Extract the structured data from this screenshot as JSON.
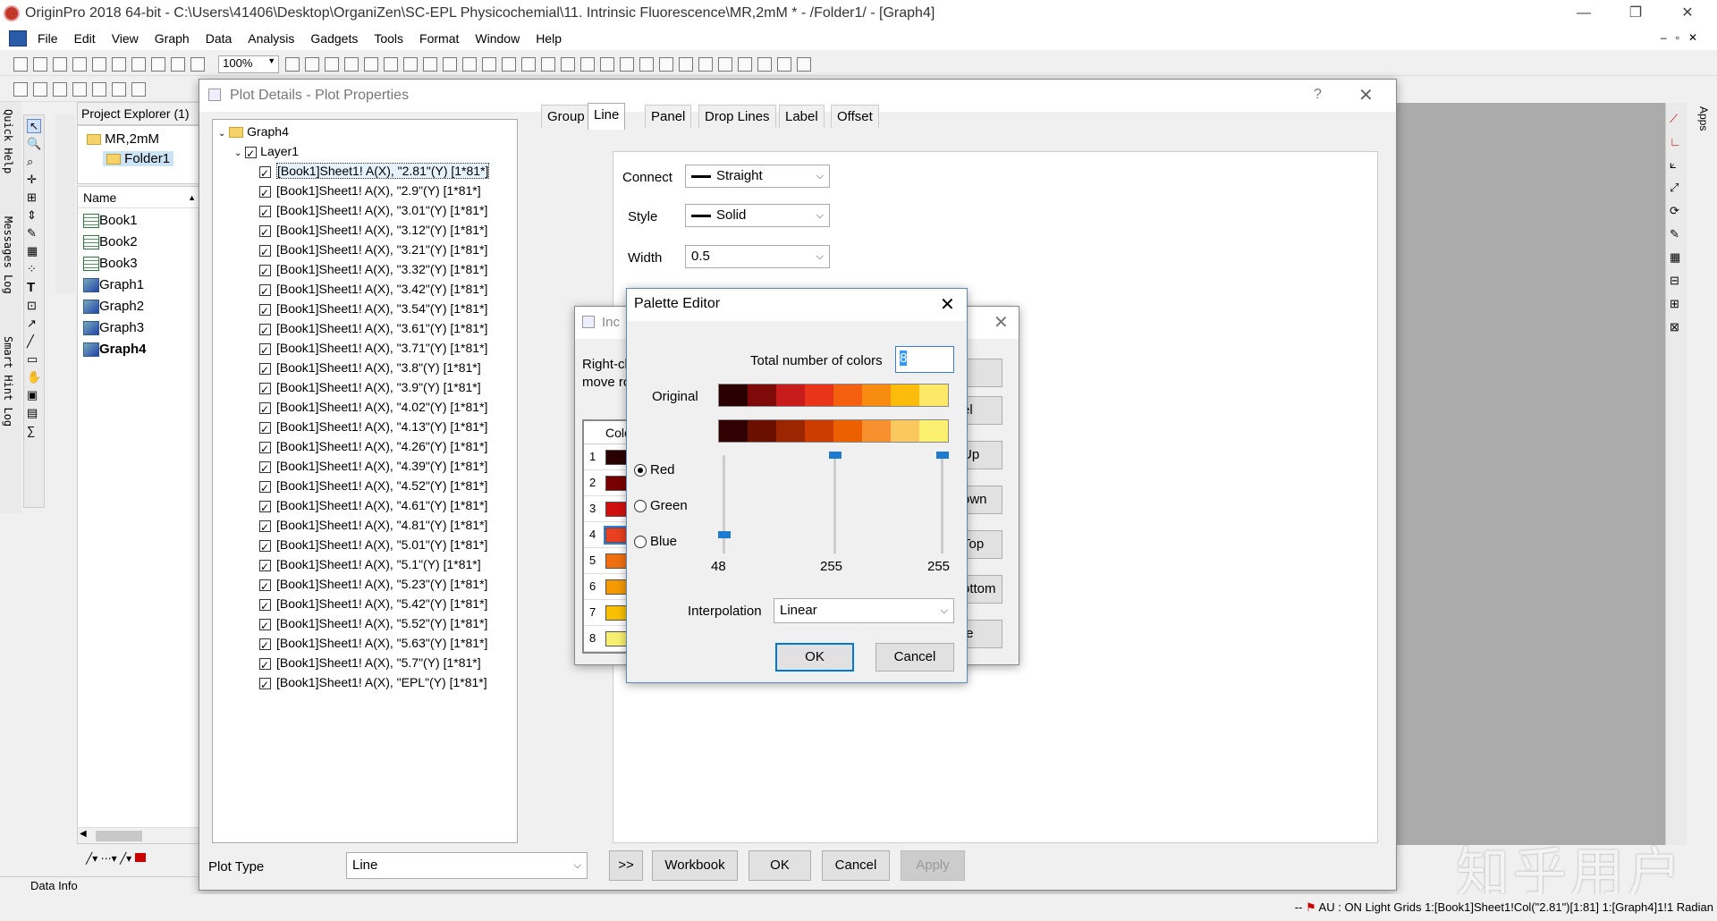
{
  "window": {
    "title": "OriginPro 2018 64-bit - C:\\Users\\41406\\Desktop\\OrganiZen\\SC-EPL Physicochemial\\11. Intrinsic Fluorescence\\MR,2mM * - /Folder1/ - [Graph4]"
  },
  "menu": [
    "File",
    "Edit",
    "View",
    "Graph",
    "Data",
    "Analysis",
    "Gadgets",
    "Tools",
    "Format",
    "Window",
    "Help"
  ],
  "toolbar": {
    "zoom": "100%"
  },
  "side_labels": {
    "quick_help": "Quick Help",
    "messages_log": "Messages Log",
    "smart_hint_log": "Smart Hint Log",
    "apps": "Apps"
  },
  "project_explorer": {
    "title": "Project Explorer (1)",
    "root": "MR,2mM",
    "folder": "Folder1",
    "name_header": "Name",
    "items": [
      "Book1",
      "Book2",
      "Book3",
      "Graph1",
      "Graph2",
      "Graph3",
      "Graph4"
    ]
  },
  "plot_details": {
    "title": "Plot Details - Plot Properties",
    "help": "?",
    "tree_root": "Graph4",
    "layer": "Layer1",
    "plots": [
      "[Book1]Sheet1! A(X), \"2.81\"(Y) [1*81*]",
      "[Book1]Sheet1! A(X), \"2.9\"(Y) [1*81*]",
      "[Book1]Sheet1! A(X), \"3.01\"(Y) [1*81*]",
      "[Book1]Sheet1! A(X), \"3.12\"(Y) [1*81*]",
      "[Book1]Sheet1! A(X), \"3.21\"(Y) [1*81*]",
      "[Book1]Sheet1! A(X), \"3.32\"(Y) [1*81*]",
      "[Book1]Sheet1! A(X), \"3.42\"(Y) [1*81*]",
      "[Book1]Sheet1! A(X), \"3.54\"(Y) [1*81*]",
      "[Book1]Sheet1! A(X), \"3.61\"(Y) [1*81*]",
      "[Book1]Sheet1! A(X), \"3.71\"(Y) [1*81*]",
      "[Book1]Sheet1! A(X), \"3.8\"(Y) [1*81*]",
      "[Book1]Sheet1! A(X), \"3.9\"(Y) [1*81*]",
      "[Book1]Sheet1! A(X), \"4.02\"(Y) [1*81*]",
      "[Book1]Sheet1! A(X), \"4.13\"(Y) [1*81*]",
      "[Book1]Sheet1! A(X), \"4.26\"(Y) [1*81*]",
      "[Book1]Sheet1! A(X), \"4.39\"(Y) [1*81*]",
      "[Book1]Sheet1! A(X), \"4.52\"(Y) [1*81*]",
      "[Book1]Sheet1! A(X), \"4.61\"(Y) [1*81*]",
      "[Book1]Sheet1! A(X), \"4.81\"(Y) [1*81*]",
      "[Book1]Sheet1! A(X), \"5.01\"(Y) [1*81*]",
      "[Book1]Sheet1! A(X), \"5.1\"(Y) [1*81*]",
      "[Book1]Sheet1! A(X), \"5.23\"(Y) [1*81*]",
      "[Book1]Sheet1! A(X), \"5.42\"(Y) [1*81*]",
      "[Book1]Sheet1! A(X), \"5.52\"(Y) [1*81*]",
      "[Book1]Sheet1! A(X), \"5.63\"(Y) [1*81*]",
      "[Book1]Sheet1! A(X), \"5.7\"(Y) [1*81*]",
      "[Book1]Sheet1! A(X), \"EPL\"(Y) [1*81*]"
    ],
    "tabs": [
      "Group",
      "Line",
      "Panel",
      "Drop Lines",
      "Label",
      "Offset"
    ],
    "connect_label": "Connect",
    "connect_value": "Straight",
    "style_label": "Style",
    "style_value": "Solid",
    "width_label": "Width",
    "width_value": "0.5",
    "plot_type_label": "Plot Type",
    "plot_type_value": "Line",
    "buttons": {
      "more": ">>",
      "workbook": "Workbook",
      "ok": "OK",
      "cancel": "Cancel",
      "apply": "Apply"
    }
  },
  "increment_dialog": {
    "title_partial": "Inc",
    "text1": "Right-cl",
    "text2": "move ro",
    "col_header": "Colo",
    "rows": [
      "1",
      "2",
      "3",
      "4",
      "5",
      "6",
      "7",
      "8"
    ],
    "row_colors": [
      "#2b0000",
      "#7a0000",
      "#d01010",
      "#e84020",
      "#f07010",
      "#f59a00",
      "#f8c000",
      "#f8f070"
    ],
    "btn_partial": [
      "el",
      "Up",
      "own",
      "Top",
      "ottom",
      "te"
    ]
  },
  "palette_editor": {
    "title": "Palette Editor",
    "total_label": "Total number of colors",
    "total_value": "8",
    "original_label": "Original",
    "original_colors": [
      "#2a0000",
      "#7f0a0a",
      "#c81c1c",
      "#e83418",
      "#f56010",
      "#f88c10",
      "#fbbc0c",
      "#fde868"
    ],
    "current_colors": [
      "#300000",
      "#6a1000",
      "#9c2600",
      "#cc3c00",
      "#ec6000",
      "#f89030",
      "#fbc860",
      "#fcf070"
    ],
    "channels": [
      "Red",
      "Green",
      "Blue"
    ],
    "selected_channel": "Red",
    "slider_values": [
      "48",
      "255",
      "255"
    ],
    "slider_levels": [
      0.19,
      1.0,
      1.0
    ],
    "interp_label": "Interpolation",
    "interp_value": "Linear",
    "ok": "OK",
    "cancel": "Cancel"
  },
  "data_info": "Data Info",
  "watermark": "知乎用户",
  "status": {
    "dashes": "--",
    "au": "AU : ON",
    "grids": "Light Grids",
    "col": "1:[Book1]Sheet1!Col(\"2.81\")[1:81]",
    "graph": "1:[Graph4]1!1",
    "angle": "Radian"
  }
}
